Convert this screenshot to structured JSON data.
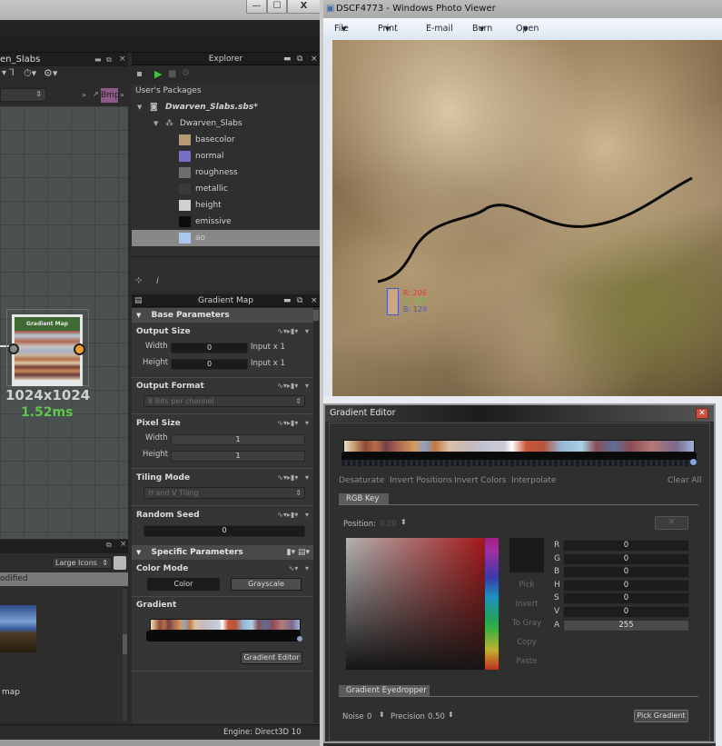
{
  "left_window": {
    "title_controls": {
      "minimize": "—",
      "maximize": "☐",
      "close": "X"
    },
    "graph_tab": {
      "title": "en_Slabs"
    },
    "graph_toolbar": {
      "combo_icon": "⇕",
      "bmp_label": "Bmp"
    },
    "node": {
      "title": "Gradient Map",
      "resolution": "1024x1024",
      "time": "1.52ms"
    },
    "library": {
      "view_mode": "Large Icons",
      "column_header": "odified",
      "item_label": "map"
    },
    "status": {
      "engine": "Engine: Direct3D 10"
    }
  },
  "explorer": {
    "title": "Explorer",
    "section_label": "User's Packages",
    "package": "Dwarven_Slabs.sbs*",
    "graph": "Dwarven_Slabs",
    "outputs": [
      {
        "label": "basecolor",
        "color": "#b89a72"
      },
      {
        "label": "normal",
        "color": "#7470c8"
      },
      {
        "label": "roughness",
        "color": "#6e6e6e"
      },
      {
        "label": "metallic",
        "color": "#3a3a3a"
      },
      {
        "label": "height",
        "color": "#d0d0d0"
      },
      {
        "label": "emissive",
        "color": "#0c0c0c"
      },
      {
        "label": "ao",
        "color": "#a9c7ec"
      }
    ],
    "selected": "ao"
  },
  "gradient_map_panel": {
    "title": "Gradient Map",
    "base_parameters": "Base Parameters",
    "output_size": {
      "title": "Output Size",
      "width_label": "Width",
      "width_value": "0",
      "width_suffix": "Input x 1",
      "height_label": "Height",
      "height_value": "0",
      "height_suffix": "Input x 1"
    },
    "output_format": {
      "title": "Output Format",
      "value": "8 Bits per channel"
    },
    "pixel_size": {
      "title": "Pixel Size",
      "width_label": "Width",
      "width_value": "1",
      "height_label": "Height",
      "height_value": "1"
    },
    "tiling_mode": {
      "title": "Tiling Mode",
      "value": "H and V Tiling"
    },
    "random_seed": {
      "title": "Random Seed",
      "value": "0"
    },
    "specific_parameters": "Specific Parameters",
    "color_mode": {
      "title": "Color Mode",
      "color_label": "Color",
      "grayscale_label": "Grayscale"
    },
    "gradient": {
      "title": "Gradient",
      "editor_button": "Gradient Editor"
    }
  },
  "photo_viewer": {
    "title": "DSCF4773 - Windows Photo Viewer",
    "menu": [
      "File",
      "Print",
      "E-mail",
      "Burn",
      "Open"
    ],
    "sample": {
      "r": "R: 206",
      "g": "G: 165",
      "b": "B: 129",
      "r_color": "#e03a2a",
      "g_color": "#6cc444",
      "b_color": "#4a5ab8"
    }
  },
  "gradient_editor": {
    "title": "Gradient Editor",
    "actions": [
      "Desaturate",
      "Invert Positions",
      "Invert Colors",
      "Interpolate"
    ],
    "clear_all": "Clear All",
    "rgb_key_tab": "RGB Key",
    "position_label": "Position:",
    "position_value": "0.00",
    "delete_key": "✕",
    "side_actions": [
      "Pick",
      "Invert",
      "To Gray",
      "Copy",
      "Paste"
    ],
    "channels": [
      {
        "label": "R",
        "value": "0"
      },
      {
        "label": "G",
        "value": "0"
      },
      {
        "label": "B",
        "value": "0"
      },
      {
        "label": "H",
        "value": "0"
      },
      {
        "label": "S",
        "value": "0"
      },
      {
        "label": "V",
        "value": "0"
      },
      {
        "label": "A",
        "value": "255"
      }
    ],
    "eyedropper_tab": "Gradient Eyedropper",
    "noise_label": "Noise",
    "noise_value": "0",
    "precision_label": "Precision",
    "precision_value": "0.50",
    "pick_gradient": "Pick Gradient"
  }
}
